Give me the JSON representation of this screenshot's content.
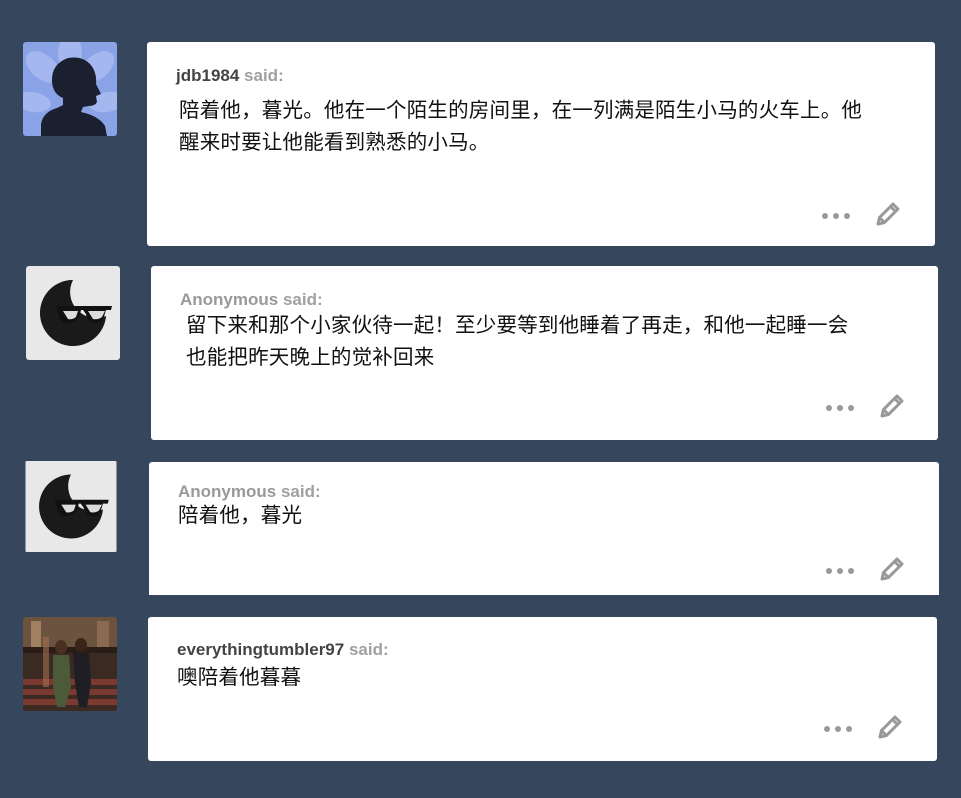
{
  "comments": [
    {
      "username": "jdb1984",
      "said_label": "said:",
      "text_lines": [
        "陪着他，暮光。他在一个陌生的房间里，在一列满是陌生小马的火车上。他",
        "醒来时要让他能看到熟悉的小马。"
      ],
      "avatar": "silhouette-avatar",
      "anonymous": false
    },
    {
      "username": "Anonymous",
      "said_label": "said:",
      "text_lines": [
        "留下来和那个小家伙待一起！至少要等到他睡着了再走，和他一起睡一会",
        "也能把昨天晚上的觉补回来"
      ],
      "avatar": "sunglasses-moon-avatar",
      "anonymous": true
    },
    {
      "username": "Anonymous",
      "said_label": "said:",
      "text_lines": [
        "陪着他，暮光"
      ],
      "avatar": "sunglasses-moon-avatar",
      "anonymous": true
    },
    {
      "username": "everythingtumbler97",
      "said_label": "said:",
      "text_lines": [
        "噢陪着他暮暮"
      ],
      "avatar": "photo-avatar",
      "anonymous": false
    }
  ],
  "icons": {
    "more": "more-dots-icon",
    "edit": "pencil-icon"
  },
  "colors": {
    "background": "#36465d",
    "card": "#ffffff",
    "icon": "#999999"
  }
}
